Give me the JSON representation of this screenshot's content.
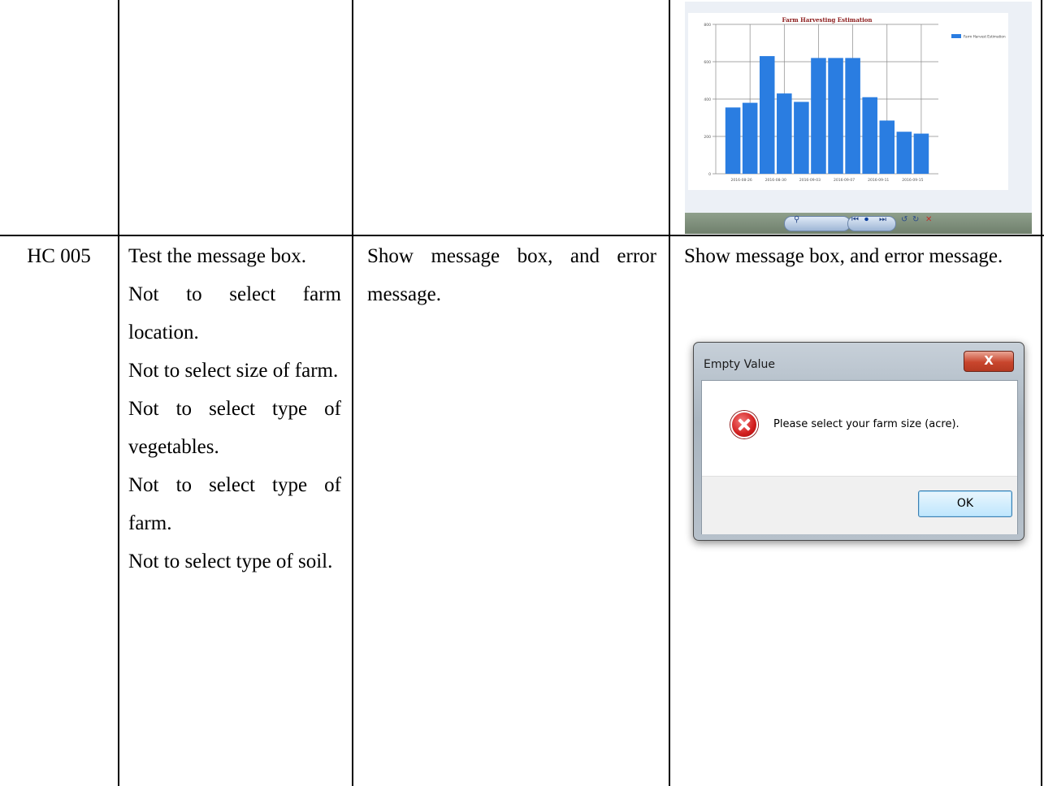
{
  "table": {
    "row": {
      "id": "HC 005",
      "description": [
        "Test the message box.",
        "Not to select farm location.",
        "Not to select size of farm.",
        "Not to select type of vegetables.",
        "Not to select type of farm.",
        "Not to select type of soil."
      ],
      "expected": "Show message box, and error message.",
      "actual": "Show message box, and error message."
    }
  },
  "chart_data": {
    "type": "bar",
    "title": "Farm Harvesting Estimation",
    "legend": "Farm Harvest Estimation",
    "legend_position": "top-right",
    "grid": true,
    "ylim": [
      0,
      800
    ],
    "yticks": [
      "0",
      "200",
      "400",
      "600",
      "800"
    ],
    "xtick_labels": [
      "2016-08-26",
      "2016-08-30",
      "2016-09-03",
      "2016-09-07",
      "2016-09-11",
      "2016-09-15"
    ],
    "values": [
      355,
      380,
      630,
      430,
      385,
      620,
      620,
      620,
      410,
      285,
      225,
      215
    ],
    "color": "#2a7de1"
  },
  "dialog": {
    "title": "Empty Value",
    "close_label": "X",
    "message": "Please select your farm size (acre).",
    "ok_label": "OK"
  }
}
